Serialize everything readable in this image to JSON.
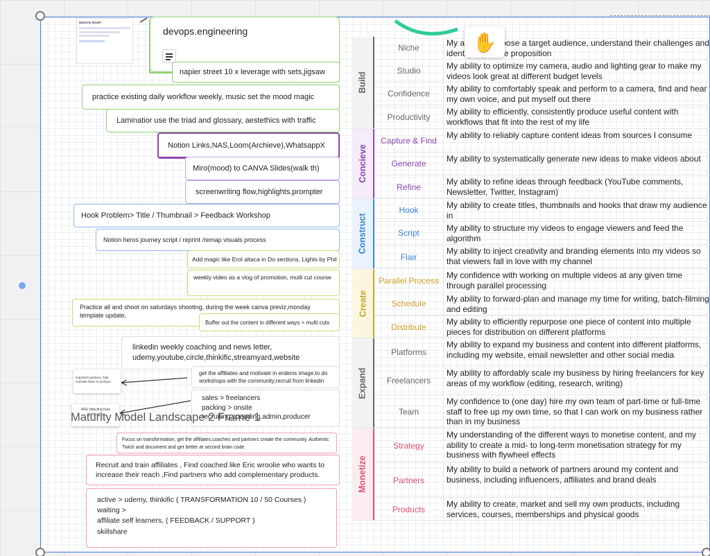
{
  "canvas": {
    "frame_caption": "Maturity Model  Landscape 2 Frame 1",
    "thumbnail_lines": [
      "Maturity Model",
      "",
      "",
      "",
      "",
      ""
    ],
    "sticky1_text": "important partners, help motivate them to produce",
    "sticky2_text": "ARU directing hour contracts"
  },
  "mindmap": {
    "root": "devops.engineering",
    "n1": "napier street 10 x leverage with sets,jigsaw",
    "n2": "practice existing daily workflow  weekly, music set the mood magic",
    "n3": "Laminatior use the triad and glossary, aestethics with traffic",
    "n4": "Notion Links,NAS,Loom(Archieve),WhatsappX",
    "n5": "Miro(mood) to CANVA Slides(walk th)",
    "n6": "screenwriting flow,highlights,prompter",
    "n7": "Hook Problem> Title / Thumbnail > Feedback Workshop",
    "n8": "Notion heros journey script / reprint /remap visuals process",
    "n9": "Add magic like Erol altaca in Do sections, Lights by Phil",
    "n10": "weekly video as a vlog of promotion, mutli cut course",
    "n11": "Practice all and shoot on saturdays shooting, during the week canva previz,monday template update,",
    "n12": "Buffer out the content in different ways > multi cuts",
    "n13": "linkedin weekly coaching and news letter, udemy,youtube,circle,thinkific,streamyard,website",
    "n14": "get the affiliates and motivate in erdems image.to do workshops with the community,recruit from linkedin",
    "n15": "sales > freelancers\npacking > onsite\nrecruiting,spending,admin,producer",
    "n16": "Focus on transformation, get the affiliates,coaches and partners create the community. Authentic Twich and document and get better at second brain code",
    "n17": "Recruit and train affiliates , Find coached like Eric wroolie who wants to increase their reach ,Find partners who add complementary products.",
    "n18": "active > udemy, thinkific ( TRANSFORMATION 10 / 50 Courses )\nwaiting >\naffiliate self learners, ( FEEDBACK / SUPPORT )\nskillshare"
  },
  "maturity": {
    "groups": [
      {
        "name": "Build",
        "color": "#666666",
        "bg": "#f2f2f2",
        "rows": [
          {
            "label": "Niche",
            "text": "My ability to choose a target audience, understand their challenges and identify my value proposition"
          },
          {
            "label": "Studio",
            "text": "My ability to optimize my camera, audio and lighting gear to make my videos look great at different budget levels"
          },
          {
            "label": "Confidence",
            "text": "My ability to comfortably speak and perform to a camera, find and hear my own voice, and put myself out there"
          },
          {
            "label": "Productivity",
            "text": "My ability to efficiently, consistently produce useful content with workflows that fit into the rest of my life"
          }
        ]
      },
      {
        "name": "Concieve",
        "color": "#8e44ad",
        "bg": "#f4ecfa",
        "rows": [
          {
            "label": "Capture & Find",
            "text": "My ability to reliably capture content ideas from sources I consume"
          },
          {
            "label": "Generate",
            "text": "My ability to systematically generate new ideas to make videos about"
          },
          {
            "label": "Refine",
            "text": "My ability to refine ideas through feedback (YouTube comments, Newsletter, Twitter, Instagram)"
          }
        ]
      },
      {
        "name": "Construct",
        "color": "#3b82d6",
        "bg": "#eaf3fd",
        "rows": [
          {
            "label": "Hook",
            "text": "My ability to create titles, thumbnails and hooks that draw my audience in"
          },
          {
            "label": "Script",
            "text": "My ability to structure my videos to engage viewers and feed the algorithm"
          },
          {
            "label": "Flair",
            "text": "My ability to inject creativity and branding elements into my videos so that viewers fall in love with my channel"
          }
        ]
      },
      {
        "name": "Create",
        "color": "#c9a227",
        "bg": "#fbf7df",
        "rows": [
          {
            "label": "Parallel Process",
            "text": "My confidence with working on multiple videos at any given time through parallel processing"
          },
          {
            "label": "Schedule",
            "text": "My ability to forward-plan and manage my time for writing, batch-filming and editing"
          },
          {
            "label": "Distribute",
            "text": "My ability to efficiently repurpose one piece of content into multiple pieces for distribution on different platforms"
          }
        ]
      },
      {
        "name": "Expand",
        "color": "#666666",
        "bg": "#f2f2f2",
        "rows": [
          {
            "label": "Platforms",
            "text": "My ability to expand my business and content into different platforms, including my website, email newsletter and other social media"
          },
          {
            "label": "Freelancers",
            "text": "My ability to affordably scale my business by hiring freelancers for key areas of my workflow (editing, research, writing)"
          },
          {
            "label": "Team",
            "text": "My confidence to (one day) hire my own team of part-time or full-time staff to free up my own time, so that I can work on my business rather than in my business"
          }
        ]
      },
      {
        "name": "Monetize",
        "color": "#d9536f",
        "bg": "#fdecef",
        "rows": [
          {
            "label": "Strategy",
            "text": "My understanding of the different ways to monetise content, and my ability to create a mid- to long-term monetisation strategy for my business with flywheel effects"
          },
          {
            "label": "Partners",
            "text": "My ability to build a network of partners around my content and business, including influencers, affiliates and brand deals"
          },
          {
            "label": "Products",
            "text": "My ability to create, market and sell my own products, including services, courses, memberships and physical goods"
          }
        ]
      }
    ]
  }
}
